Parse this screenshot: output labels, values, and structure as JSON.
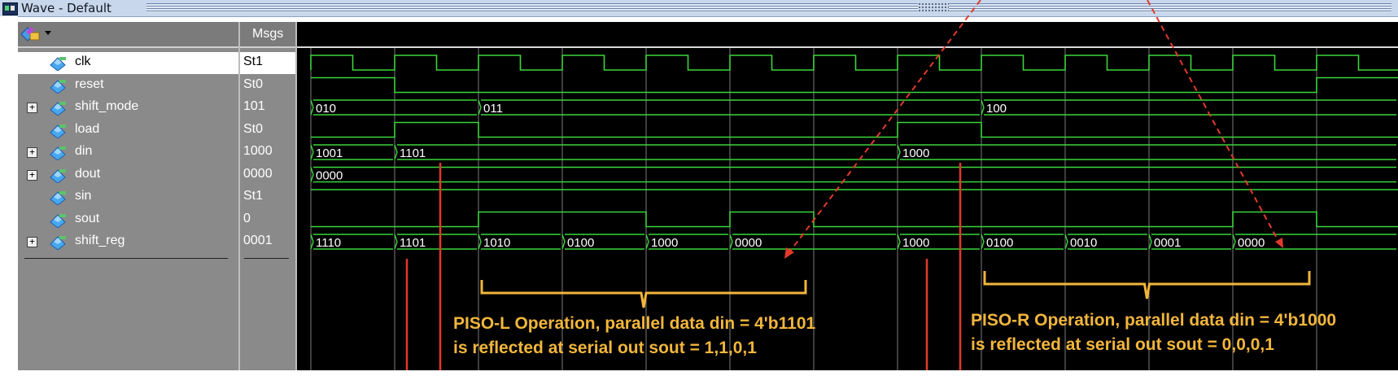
{
  "window": {
    "title": "Wave - Default"
  },
  "columns": {
    "msgs": "Msgs"
  },
  "signals": [
    {
      "name": "clk",
      "value": "St1",
      "expandable": false,
      "selected": true
    },
    {
      "name": "reset",
      "value": "St0",
      "expandable": false
    },
    {
      "name": "shift_mode",
      "value": "101",
      "expandable": true
    },
    {
      "name": "load",
      "value": "St0",
      "expandable": false
    },
    {
      "name": "din",
      "value": "1000",
      "expandable": true
    },
    {
      "name": "dout",
      "value": "0000",
      "expandable": true
    },
    {
      "name": "sin",
      "value": "St1",
      "expandable": false
    },
    {
      "name": "sout",
      "value": "0",
      "expandable": false
    },
    {
      "name": "shift_reg",
      "value": "0001",
      "expandable": true
    }
  ],
  "bus_values": {
    "shift_mode": [
      "010",
      "011",
      "100"
    ],
    "din": [
      "1001",
      "1101",
      "1000"
    ],
    "dout": [
      "0000"
    ],
    "shift_reg": [
      "1110",
      "1101",
      "1010",
      "0100",
      "1000",
      "0000",
      "1000",
      "0100",
      "0010",
      "0001",
      "0000"
    ]
  },
  "annotations": [
    {
      "line1": "PISO-L Operation, parallel data din = 4'b1101",
      "line2": "is reflected at serial out sout = 1,1,0,1"
    },
    {
      "line1": "PISO-R Operation, parallel data din = 4'b1000",
      "line2": "is reflected at serial out sout = 0,0,0,1"
    }
  ],
  "colors": {
    "wave": "#3bd63b",
    "bus_text": "#ffffff",
    "annotation_text": "#f2b63c",
    "brace": "#f2b63c",
    "marker": "#e23a2a",
    "grid": "#9a9a9a"
  },
  "icons": {
    "window": "wave-window-icon",
    "toolbar": "wave-signal-icon",
    "signal": "signal-diamond-icon",
    "expand": "plus-box-icon"
  }
}
